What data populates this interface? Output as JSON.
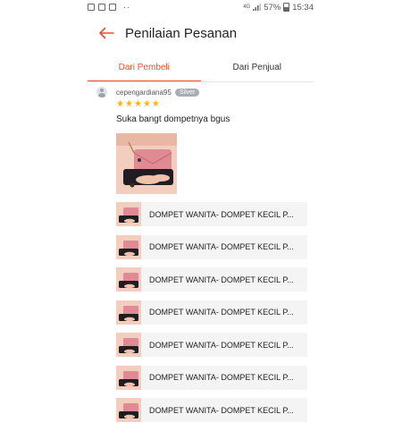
{
  "status_bar": {
    "network_type": "4G",
    "battery": "57%",
    "time": "15:34",
    "extra": "··"
  },
  "header": {
    "title": "Penilaian Pesanan",
    "back_icon": "arrow-left-icon"
  },
  "tabs": [
    {
      "label": "Dari Pembeli",
      "active": true
    },
    {
      "label": "Dari Penjual",
      "active": false
    }
  ],
  "review": {
    "username": "cepengardiana95",
    "badge": "Silver",
    "rating": 5,
    "comment": "Suka bangt dompetnya bgus"
  },
  "products": [
    {
      "name": "DOMPET WANITA- DOMPET KECIL P..."
    },
    {
      "name": "DOMPET WANITA- DOMPET KECIL P..."
    },
    {
      "name": "DOMPET WANITA- DOMPET KECIL P..."
    },
    {
      "name": "DOMPET WANITA- DOMPET KECIL P..."
    },
    {
      "name": "DOMPET WANITA- DOMPET KECIL P..."
    },
    {
      "name": "DOMPET WANITA- DOMPET KECIL P..."
    },
    {
      "name": "DOMPET WANITA- DOMPET KECIL P..."
    }
  ],
  "colors": {
    "accent": "#ee4d2d",
    "star": "#ffb400",
    "badge": "#a9adb3"
  }
}
